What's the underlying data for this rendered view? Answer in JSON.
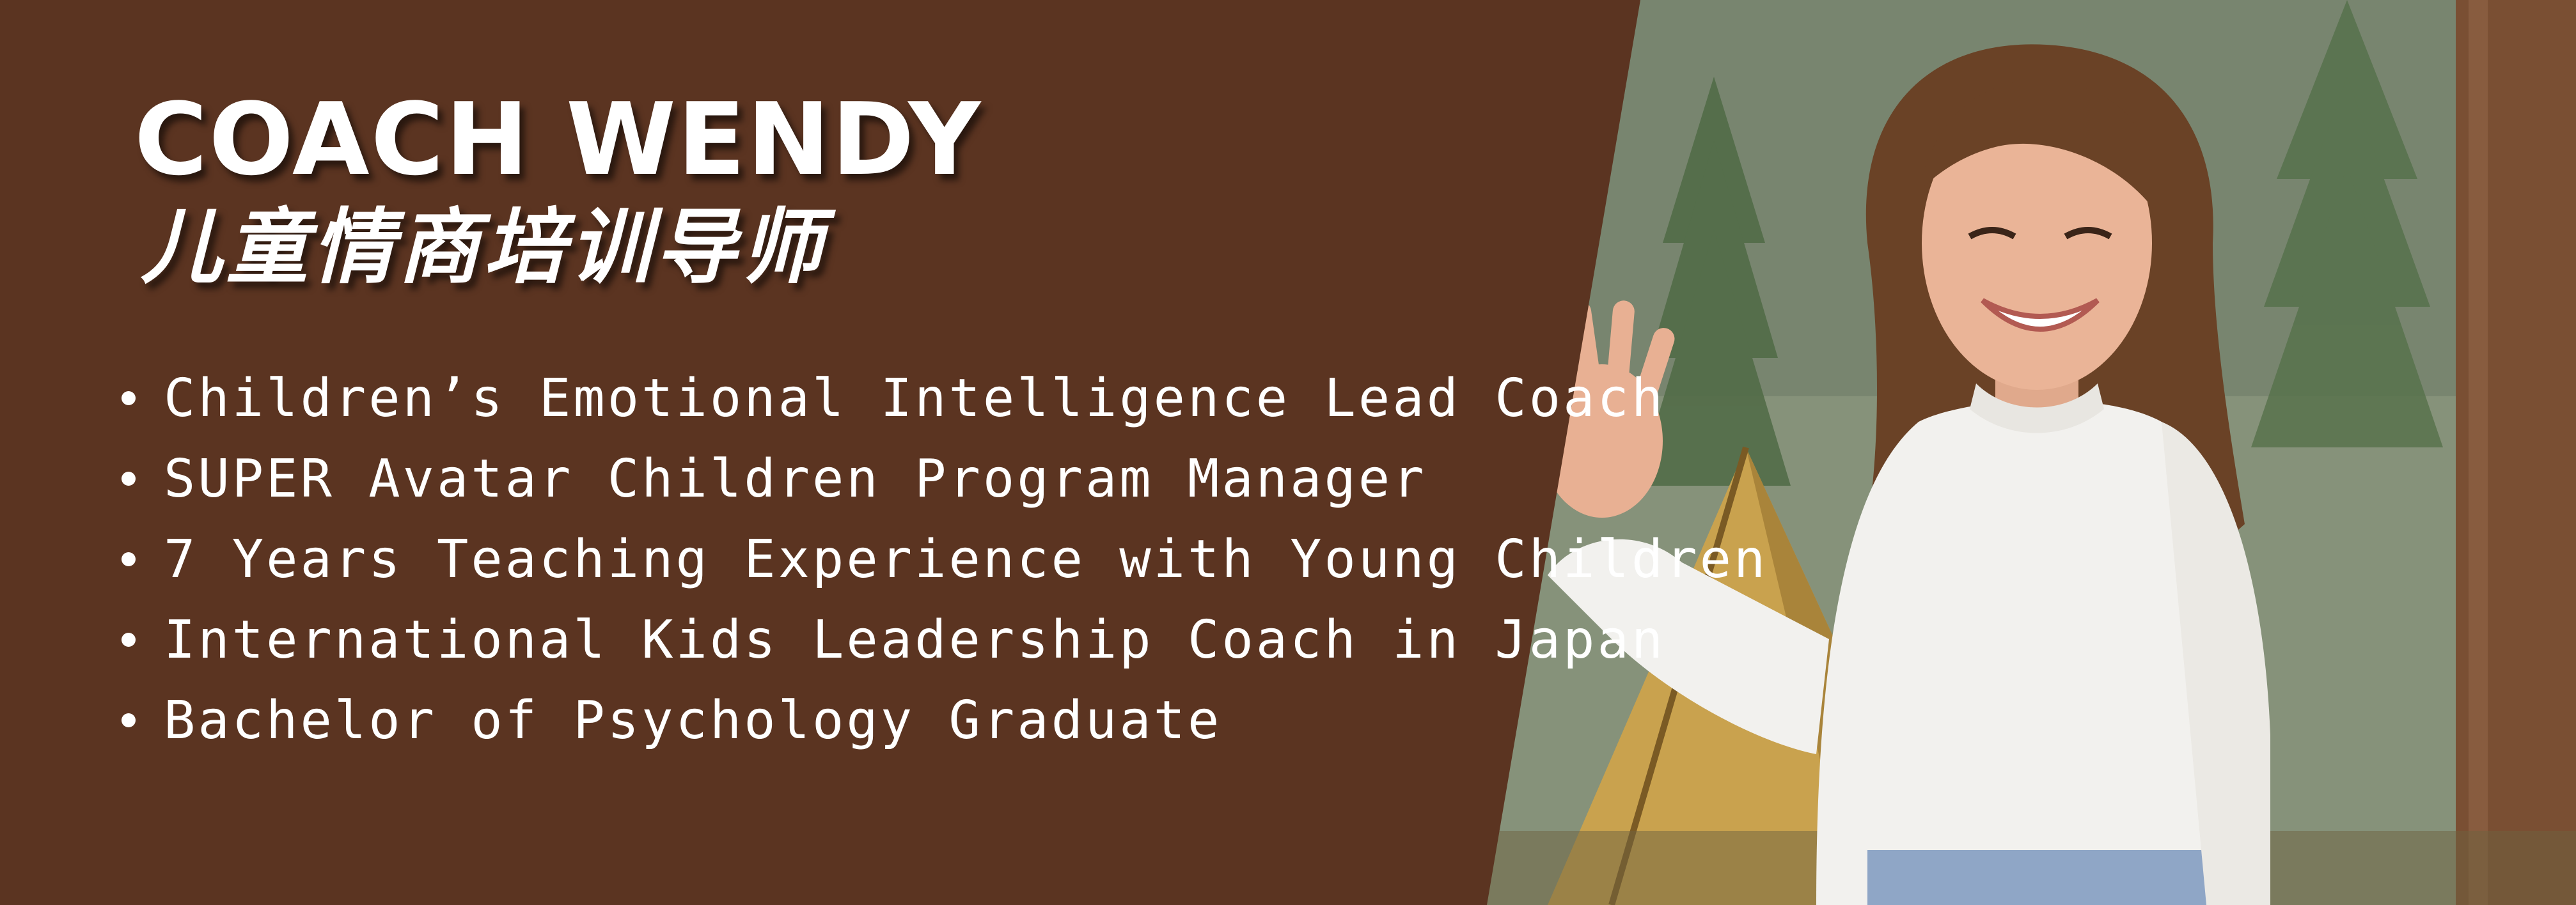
{
  "banner": {
    "title_en": "COACH WENDY",
    "title_cn": "儿童情商培训导师",
    "bullets": [
      "Children’s Emotional Intelligence Lead Coach",
      "SUPER Avatar Children Program Manager",
      "7 Years Teaching Experience with Young Children",
      "International Kids Leadership Coach in Japan",
      "Bachelor of Psychology Graduate"
    ]
  },
  "colors": {
    "panel_brown": "#5b3421",
    "text_white": "#ffffff",
    "sweater_white": "#f2f1ee",
    "hair_brown": "#6a4226",
    "tent_yellow": "#c9a24e"
  },
  "photo": {
    "subject": "smiling woman waving in forest with tent"
  }
}
